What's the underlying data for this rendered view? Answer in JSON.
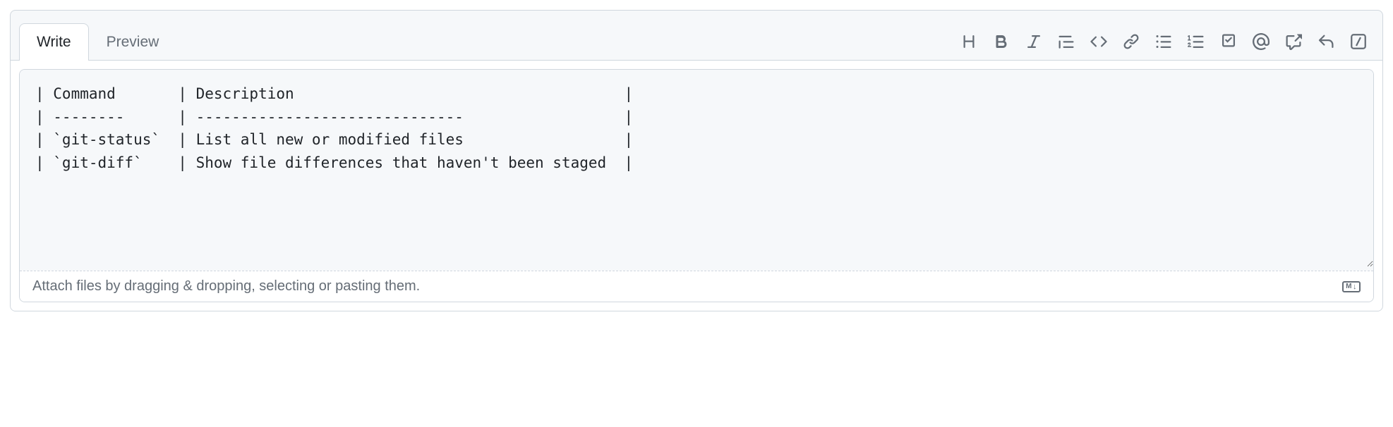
{
  "tabs": {
    "write": "Write",
    "preview": "Preview"
  },
  "editor": {
    "content": "| Command       | Description                                     |\n| --------      | ------------------------------                  |\n| `git-status`  | List all new or modified files                  |\n| `git-diff`    | Show file differences that haven't been staged  |"
  },
  "footer": {
    "hint": "Attach files by dragging & dropping, selecting or pasting them.",
    "md_label": "M"
  },
  "icons": {
    "heading": "heading-icon",
    "bold": "bold-icon",
    "italic": "italic-icon",
    "quote": "quote-icon",
    "code": "code-icon",
    "link": "link-icon",
    "ul": "unordered-list-icon",
    "ol": "ordered-list-icon",
    "task": "task-list-icon",
    "mention": "mention-icon",
    "reference": "cross-reference-icon",
    "reply": "reply-icon",
    "slash": "slash-commands-icon"
  }
}
